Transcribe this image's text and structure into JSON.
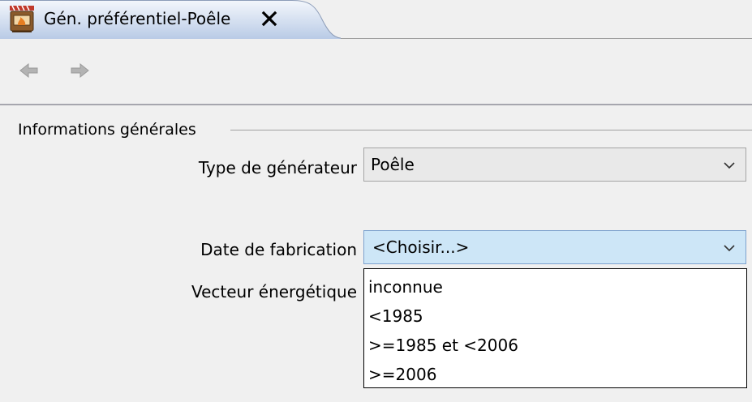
{
  "tab": {
    "title": "Gén. préférentiel-Poêle",
    "icon": "stove-icon",
    "close_icon": "close-icon"
  },
  "toolbar": {
    "back_icon": "arrow-left-icon",
    "forward_icon": "arrow-right-icon"
  },
  "form": {
    "group_title": "Informations générales",
    "type_generateur": {
      "label": "Type de générateur",
      "value": "Poêle"
    },
    "date_fabrication": {
      "label": "Date de fabrication",
      "value": "<Choisir...>",
      "options": [
        "inconnue",
        "<1985",
        ">=1985 et <2006",
        ">=2006"
      ]
    },
    "vecteur_energetique": {
      "label": "Vecteur énergétique"
    }
  },
  "colors": {
    "background": "#f0f0f0",
    "combo_focus": "#cde6f7",
    "combo_focus_border": "#7da2ce",
    "tab_gradient_top": "#e8eef8",
    "tab_gradient_bottom": "#b9cbe6"
  }
}
